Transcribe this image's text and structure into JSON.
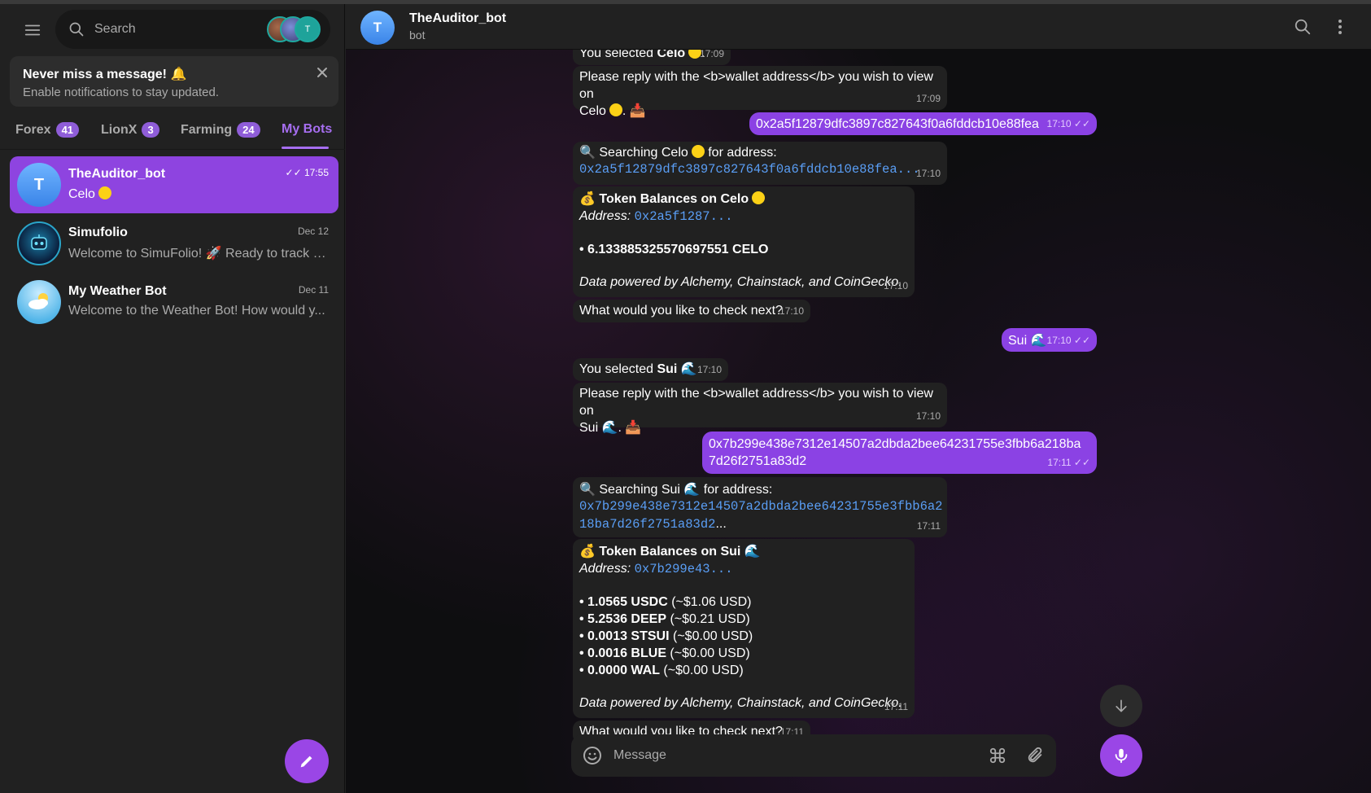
{
  "sidebar": {
    "search_placeholder": "Search",
    "story_initial": "T",
    "notification": {
      "title": "Never miss a message! 🔔",
      "subtitle": "Enable notifications to stay updated."
    },
    "tabs": [
      {
        "label": "Forex",
        "badge": "41"
      },
      {
        "label": "LionX",
        "badge": "3"
      },
      {
        "label": "Farming",
        "badge": "24"
      },
      {
        "label": "My Bots",
        "badge": ""
      }
    ],
    "chats": [
      {
        "initial": "T",
        "name": "TheAuditor_bot",
        "message": "Celo",
        "time": "✓✓ 17:55"
      },
      {
        "initial": "",
        "name": "Simufolio",
        "message": "Welcome to SimuFolio! 🚀 Ready to track y...",
        "time": "Dec 12"
      },
      {
        "initial": "",
        "name": "My Weather Bot",
        "message": "Welcome to the Weather Bot! How would y...",
        "time": "Dec 11"
      }
    ]
  },
  "header": {
    "initial": "T",
    "name": "TheAuditor_bot",
    "status": "bot"
  },
  "messages": {
    "m0": {
      "pre": "You selected ",
      "bold": "Celo",
      "post": ".",
      "time": "17:09"
    },
    "m1": {
      "line1": "Please reply with the <b>wallet address</b> you wish to view on",
      "line2": "Celo",
      "line2_suffix": ". 📥",
      "time": "17:09"
    },
    "m2": {
      "text": "0x2a5f12879dfc3897c827643f0a6fddcb10e88fea",
      "time": "17:10",
      "ticks": "✓✓"
    },
    "m3": {
      "line1_pre": "🔍 Searching Celo",
      "line1_post": "for address:",
      "address": "0x2a5f12879dfc3897c827643f0a6fddcb10e88fea...",
      "time": "17:10"
    },
    "m4": {
      "title": "💰 Token Balances on Celo",
      "address_label": "Address:",
      "address": "0x2a5f1287...",
      "balance": "• 6.133885325570697551 CELO",
      "footer": "Data powered by Alchemy, Chainstack, and CoinGecko.",
      "time": "17:10"
    },
    "m5": {
      "text": "What would you like to check next?",
      "time": "17:10"
    },
    "m6": {
      "text": "Sui 🌊",
      "time": "17:10",
      "ticks": "✓✓"
    },
    "m7": {
      "pre": "You selected ",
      "bold": "Sui",
      "post": " 🌊",
      "time": "17:10"
    },
    "m8": {
      "line1": "Please reply with the <b>wallet address</b> you wish to view on",
      "line2": "Sui 🌊. 📥",
      "time": "17:10"
    },
    "m9": {
      "line1": "0x7b299e438e7312e14507a2dbda2bee64231755e3fbb6a218ba",
      "line2": "7d26f2751a83d2",
      "time": "17:11",
      "ticks": "✓✓"
    },
    "m10": {
      "line1": "🔍 Searching Sui 🌊 for address:",
      "address1": "0x7b299e438e7312e14507a2dbda2bee64231755e3fbb6a2",
      "address2": "18ba7d26f2751a83d2",
      "address2_suffix": "...",
      "time": "17:11"
    },
    "m11": {
      "title": "💰 Token Balances on Sui 🌊",
      "address_label": "Address:",
      "address": "0x7b299e43...",
      "balances": [
        {
          "amount": "• 1.0565 USDC",
          "usd": " (~$1.06 USD)"
        },
        {
          "amount": "• 5.2536 DEEP",
          "usd": " (~$0.21 USD)"
        },
        {
          "amount": "• 0.0013 STSUI",
          "usd": " (~$0.00 USD)"
        },
        {
          "amount": "• 0.0016 BLUE",
          "usd": " (~$0.00 USD)"
        },
        {
          "amount": "• 0.0000 WAL",
          "usd": " (~$0.00 USD)"
        }
      ],
      "footer": "Data powered by Alchemy, Chainstack, and CoinGecko.",
      "time": "17:11"
    },
    "m12": {
      "text": "What would you like to check next?",
      "time": "17:11"
    }
  },
  "composer": {
    "placeholder": "Message"
  },
  "colors": {
    "accent": "#8b42e4",
    "link": "#5a9ef5",
    "bubble_in": "#212121",
    "celo_yellow": "#fcd116"
  },
  "icons": [
    "menu-icon",
    "search-icon",
    "close-icon",
    "pencil-icon",
    "more-icon",
    "emoji-icon",
    "command-icon",
    "attach-icon",
    "microphone-icon",
    "arrow-down-icon"
  ]
}
